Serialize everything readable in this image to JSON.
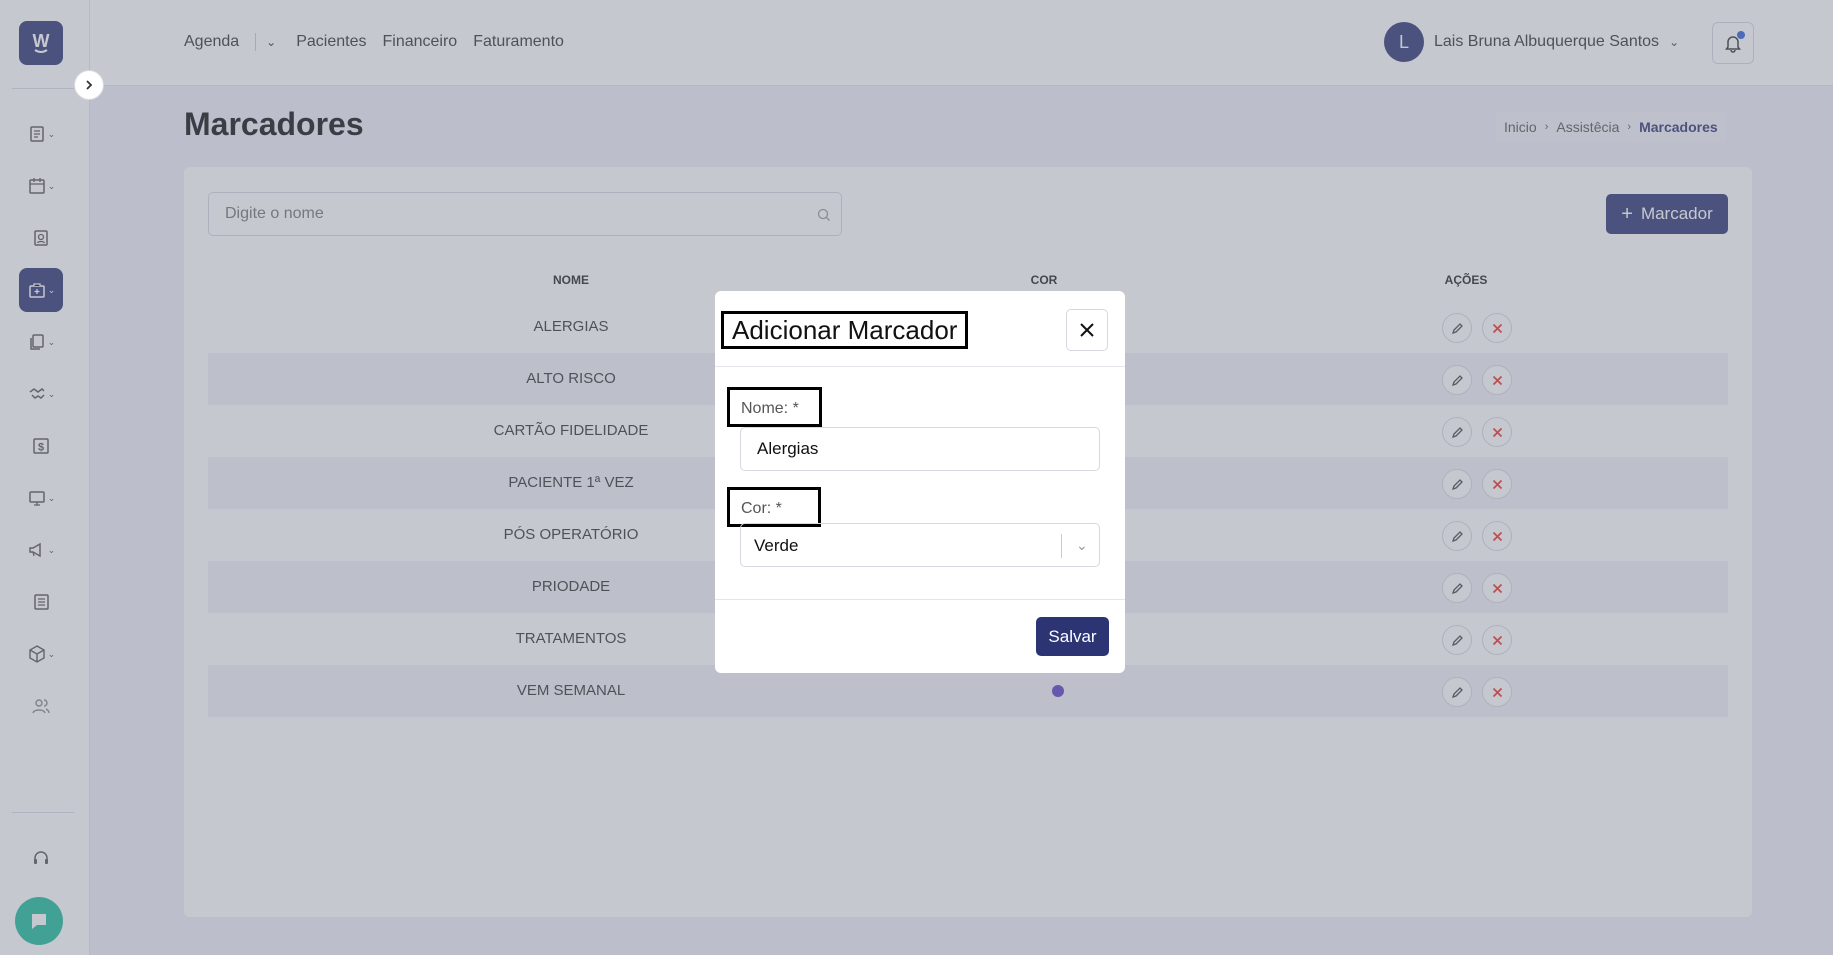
{
  "app": {
    "logo_letter": "W"
  },
  "topbar": {
    "nav": [
      "Agenda",
      "Pacientes",
      "Financeiro",
      "Faturamento"
    ],
    "user_initial": "L",
    "user_name": "Lais Bruna Albuquerque Santos"
  },
  "page": {
    "title": "Marcadores",
    "breadcrumb": [
      "Inicio",
      "Assistêcia",
      "Marcadores"
    ]
  },
  "toolbar": {
    "search_placeholder": "Digite o nome",
    "add_label": "Marcador"
  },
  "table": {
    "headers": [
      "NOME",
      "COR",
      "AÇÕES"
    ],
    "rows": [
      {
        "name": "ALERGIAS"
      },
      {
        "name": "ALTO RISCO"
      },
      {
        "name": "CARTÃO FIDELIDADE"
      },
      {
        "name": "PACIENTE 1ª VEZ"
      },
      {
        "name": "PÓS OPERATÓRIO"
      },
      {
        "name": "PRIODADE"
      },
      {
        "name": "TRATAMENTOS"
      },
      {
        "name": "VEM SEMANAL",
        "color": "#5b3fc4"
      }
    ]
  },
  "modal": {
    "title": "Adicionar Marcador",
    "name_label": "Nome: *",
    "name_value": "Alergias",
    "color_label": "Cor: *",
    "color_value": "Verde",
    "save_label": "Salvar"
  },
  "colors": {
    "primary": "#2c3474",
    "danger": "#e3342f",
    "chat": "#1abc9c"
  }
}
